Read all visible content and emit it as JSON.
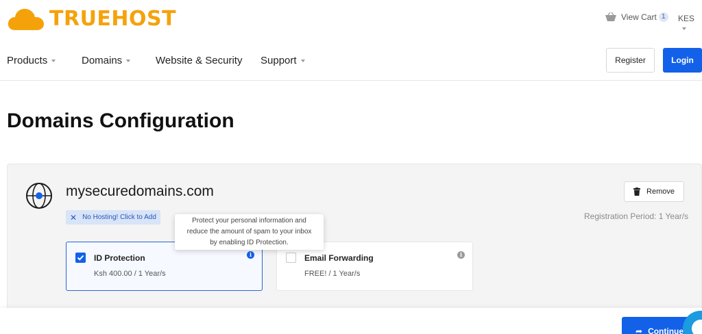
{
  "brand": {
    "name": "TRUEHOST",
    "color": "#f5a20a",
    "logo_icon": "cloud-icon"
  },
  "header": {
    "cart_label": "View Cart",
    "cart_count": "1",
    "currency": "KES"
  },
  "nav": {
    "items": [
      {
        "label": "Products",
        "has_dropdown": true
      },
      {
        "label": "Domains",
        "has_dropdown": true
      },
      {
        "label": "Website & Security",
        "has_dropdown": false
      },
      {
        "label": "Support",
        "has_dropdown": true
      }
    ],
    "register_label": "Register",
    "login_label": "Login"
  },
  "page": {
    "title": "Domains Configuration"
  },
  "domain": {
    "name": "mysecuredomains.com",
    "hosting_badge": "No Hosting! Click to Add",
    "remove_label": "Remove",
    "registration_period": "Registration Period: 1 Year/s",
    "addons": [
      {
        "name": "ID Protection",
        "price": "Ksh 400.00 / 1 Year/s",
        "checked": true
      },
      {
        "name": "Email Forwarding",
        "price": "FREE! / 1 Year/s",
        "checked": false
      }
    ],
    "tooltip_lines": [
      "Protect your personal information and",
      "reduce the amount of spam to your inbox",
      "by enabling ID Protection."
    ]
  },
  "footer": {
    "continue_label": "Continue"
  },
  "colors": {
    "primary": "#1261e8",
    "badge_bg": "#d8e4f7",
    "chat": "#1b9be0"
  }
}
